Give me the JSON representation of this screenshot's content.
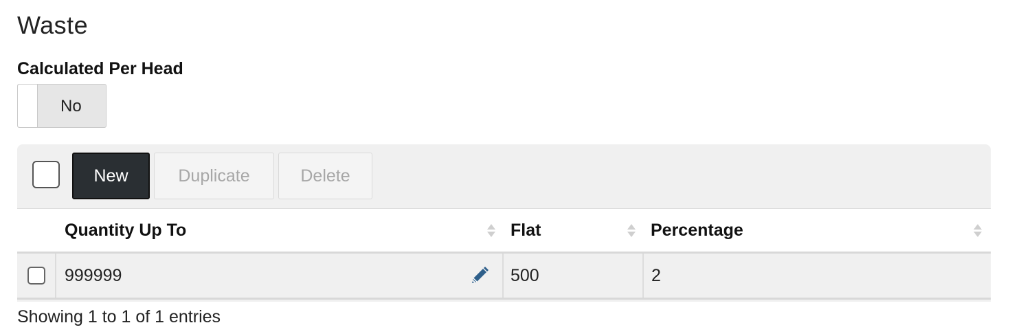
{
  "section": {
    "title": "Waste"
  },
  "per_head": {
    "label": "Calculated Per Head",
    "toggle_text": "No",
    "checked": false
  },
  "toolbar": {
    "new_label": "New",
    "duplicate_label": "Duplicate",
    "delete_label": "Delete"
  },
  "table": {
    "columns": [
      "Quantity Up To",
      "Flat",
      "Percentage"
    ],
    "rows": [
      {
        "quantity_up_to": "999999",
        "flat": "500",
        "percentage": "2"
      }
    ]
  },
  "footer": {
    "info": "Showing 1 to 1 of 1 entries"
  },
  "icons": {
    "row_edit": "pencil-icon",
    "sort": "sort-icon"
  },
  "colors": {
    "primary_button": "#2a2f33",
    "edit_icon": "#2e5f8a",
    "grid_bg": "#f0f0f0"
  }
}
